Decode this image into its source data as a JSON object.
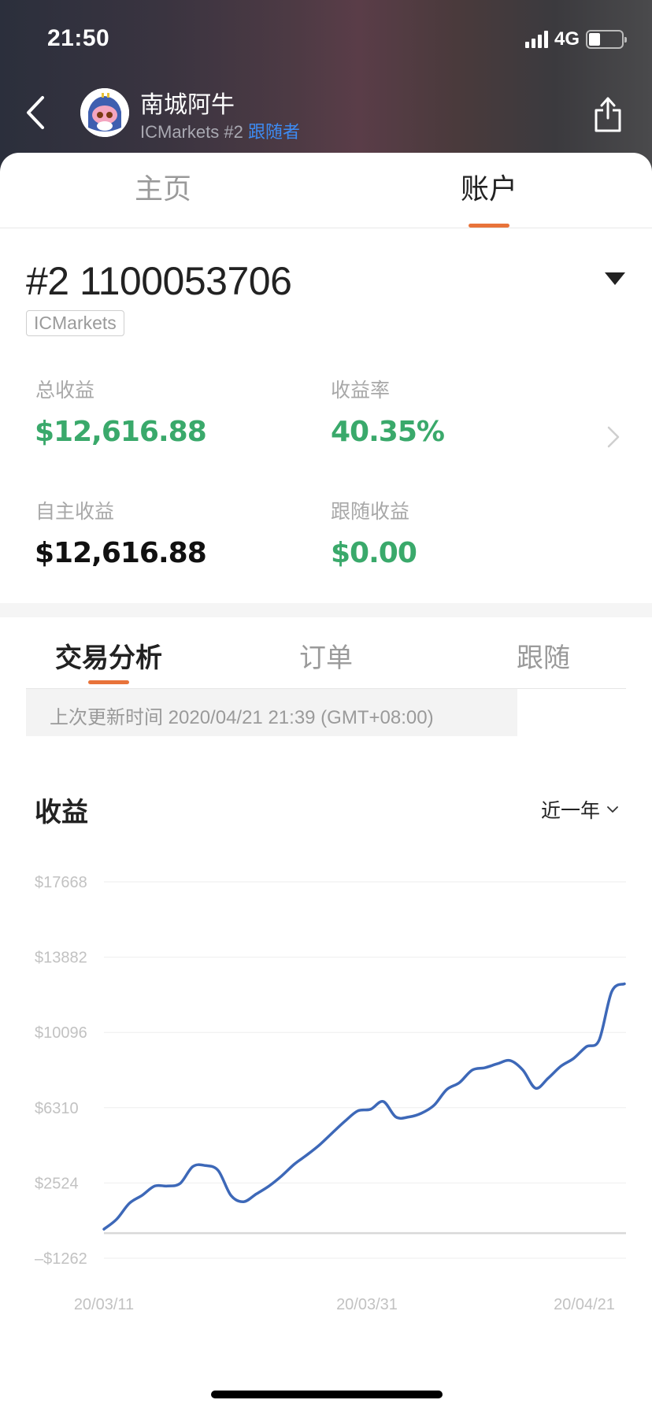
{
  "status_bar": {
    "time": "21:50",
    "network": "4G",
    "battery_level": 0.3
  },
  "nav": {
    "name": "南城阿牛",
    "broker": "ICMarkets #2",
    "role": "跟随者"
  },
  "top_tabs": [
    {
      "label": "主页",
      "active": false
    },
    {
      "label": "账户",
      "active": true
    }
  ],
  "account": {
    "id": "#2 1100053706",
    "broker_tag": "ICMarkets",
    "stats": {
      "total_profit_label": "总收益",
      "total_profit": "$12,616.88",
      "return_rate_label": "收益率",
      "return_rate": "40.35%",
      "own_profit_label": "自主收益",
      "own_profit": "$12,616.88",
      "follow_profit_label": "跟随收益",
      "follow_profit": "$0.00"
    }
  },
  "sub_tabs": [
    {
      "label": "交易分析",
      "active": true
    },
    {
      "label": "订单",
      "active": false
    },
    {
      "label": "跟随",
      "active": false
    }
  ],
  "update_text": "上次更新时间 2020/04/21 21:39 (GMT+08:00)",
  "chart_header": {
    "title": "收益",
    "range": "近一年"
  },
  "colors": {
    "accent": "#e8733a",
    "positive": "#3aa96b",
    "line": "#3d68b8",
    "link": "#3d8bf2"
  },
  "chart_data": {
    "type": "line",
    "title": "收益",
    "xlabel": "",
    "ylabel": "",
    "x_tick_labels": [
      "20/03/11",
      "20/03/31",
      "20/04/21"
    ],
    "y_tick_labels": [
      "$17668",
      "$13882",
      "$10096",
      "$6310",
      "$2524",
      "–$1262"
    ],
    "y_ticks": [
      17668,
      13882,
      10096,
      6310,
      2524,
      -1262
    ],
    "ylim": [
      -1262,
      17668
    ],
    "grid": true,
    "series": [
      {
        "name": "收益",
        "values": [
          200,
          700,
          1500,
          1900,
          2370,
          2370,
          2500,
          3350,
          3400,
          3150,
          1900,
          1580,
          1970,
          2370,
          2880,
          3470,
          3940,
          4450,
          5050,
          5640,
          6150,
          6230,
          6620,
          5840,
          5840,
          6030,
          6430,
          7220,
          7570,
          8200,
          8320,
          8520,
          8680,
          8200,
          7290,
          7800,
          8400,
          8790,
          9380,
          9700,
          12150,
          12540
        ]
      }
    ]
  }
}
